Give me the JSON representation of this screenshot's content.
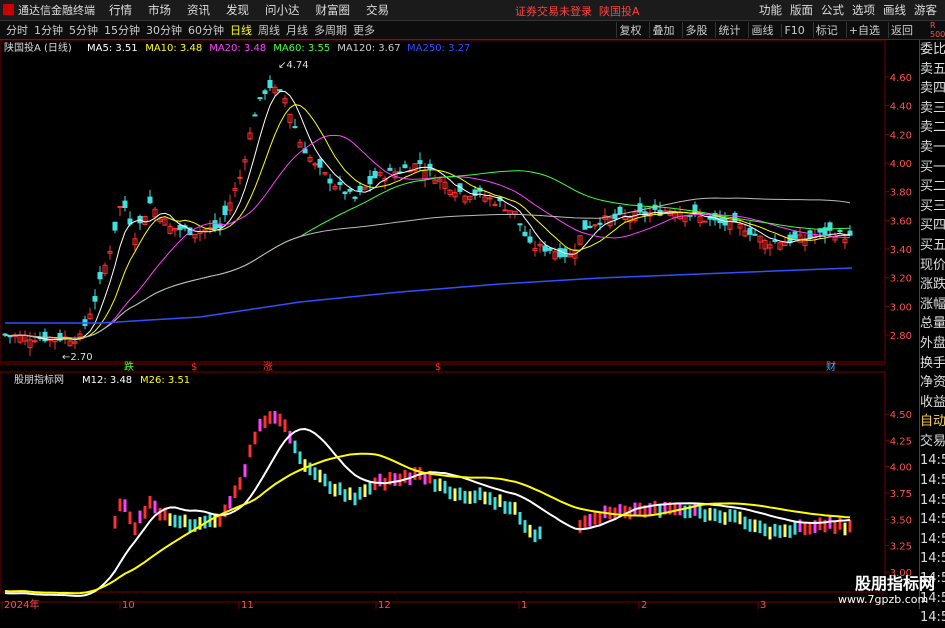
{
  "app": {
    "name": "通达信金融终端",
    "menu": [
      "行情",
      "市场",
      "资讯",
      "发现",
      "问小达",
      "财富圈",
      "交易"
    ],
    "notice": "证券交易未登录",
    "stock_name": "陕国投A",
    "right_menu": [
      "功能",
      "版面",
      "公式",
      "选项",
      "画线",
      "游客"
    ]
  },
  "toolbar": {
    "timeframes": [
      "分时",
      "1分钟",
      "5分钟",
      "15分钟",
      "30分钟",
      "60分钟",
      "日线",
      "周线",
      "月线",
      "多周期",
      "更多"
    ],
    "active": "日线",
    "right": [
      "复权",
      "叠加",
      "多股",
      "统计",
      "画线",
      "F10",
      "标记",
      "+自选",
      "返回"
    ]
  },
  "right_side": {
    "small_top": "R\n500",
    "items": [
      "委比",
      "卖五",
      "卖四",
      "卖三",
      "卖二",
      "卖一",
      "买一",
      "买二",
      "买三",
      "买四",
      "买五",
      "现价",
      "涨跌",
      "涨幅",
      "总量",
      "外盘",
      "换手",
      "净资",
      "收益",
      "自动",
      "交易",
      "14:56",
      "14:56",
      "14:56",
      "14:56",
      "14:56",
      "14:56",
      "14:56",
      "14:56",
      "14:56"
    ]
  },
  "main_chart": {
    "legend_name": "陕国投A (日线)",
    "ma": [
      {
        "label": "MA5: 3.51",
        "color": "#ffffff"
      },
      {
        "label": "MA10: 3.48",
        "color": "#ffff00"
      },
      {
        "label": "MA20: 3.48",
        "color": "#ff40ff"
      },
      {
        "label": "MA60: 3.55",
        "color": "#40ff40"
      },
      {
        "label": "MA120: 3.67",
        "color": "#cccccc"
      },
      {
        "label": "MA250: 3.27",
        "color": "#3050ff"
      }
    ],
    "y_ticks": [
      "4.60",
      "4.40",
      "4.20",
      "4.00",
      "3.80",
      "3.60",
      "3.40",
      "3.20",
      "3.00",
      "2.80"
    ],
    "high_label": "4.74",
    "low_label": "2.70",
    "markers": [
      {
        "text": "跌",
        "color": "#40ff40"
      },
      {
        "text": "$",
        "color": "#ff3030"
      },
      {
        "text": "涨",
        "color": "#ff3030"
      },
      {
        "text": "$",
        "color": "#ff3030"
      },
      {
        "text": "财",
        "color": "#40aaff"
      }
    ]
  },
  "indicator": {
    "name": "股朋指标网",
    "m12": "M12: 3.48",
    "m26": "M26: 3.51",
    "y_ticks": [
      "4.50",
      "4.25",
      "4.00",
      "3.75",
      "3.50",
      "3.25",
      "3.00"
    ]
  },
  "x_axis": [
    "2024年",
    "10",
    "11",
    "12",
    "1",
    "2",
    "3"
  ],
  "watermark": {
    "line1": "股朋指标网",
    "line2": "www.7gpzb.com"
  }
}
